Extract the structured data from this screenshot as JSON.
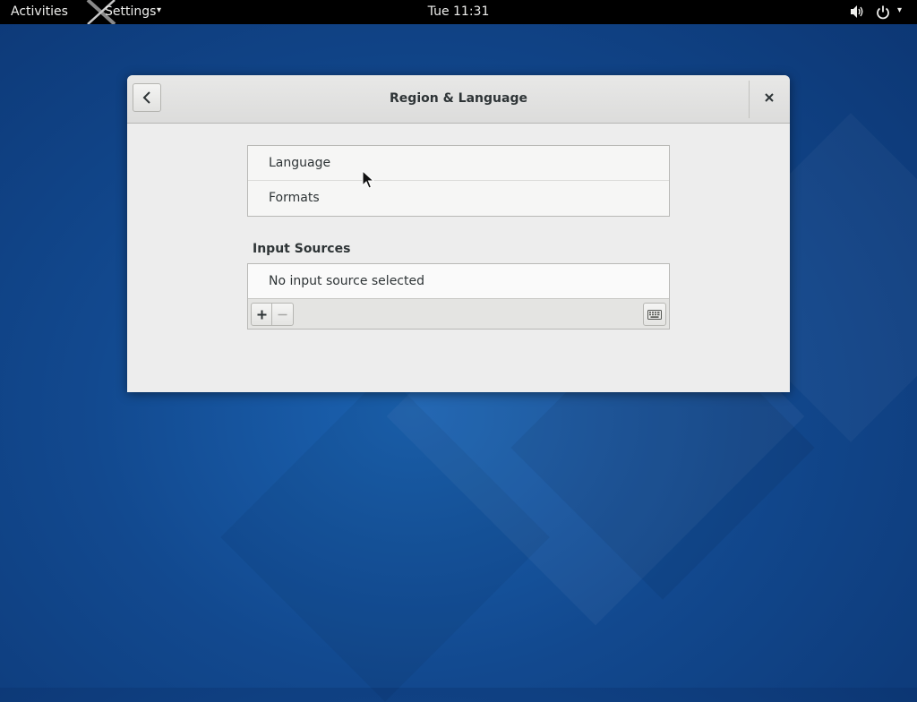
{
  "topbar": {
    "activities": "Activities",
    "app_menu": "Settings",
    "clock": "Tue 11:31",
    "icons": {
      "app": "x-logo-icon",
      "volume": "volume-icon",
      "power": "power-icon"
    }
  },
  "window": {
    "title": "Region & Language",
    "icons": {
      "back": "chevron-left-icon",
      "close": "close-icon"
    },
    "language_list": [
      {
        "label": "Language"
      },
      {
        "label": "Formats"
      }
    ],
    "input_sources": {
      "title": "Input Sources",
      "empty_text": "No input source selected",
      "icons": {
        "add": "plus-icon",
        "remove": "minus-icon",
        "keyboard": "keyboard-icon"
      }
    }
  },
  "colors": {
    "desktop": "#12498f",
    "window_bg": "#ededed",
    "topbar_bg": "#000000",
    "text": "#2e3436"
  }
}
